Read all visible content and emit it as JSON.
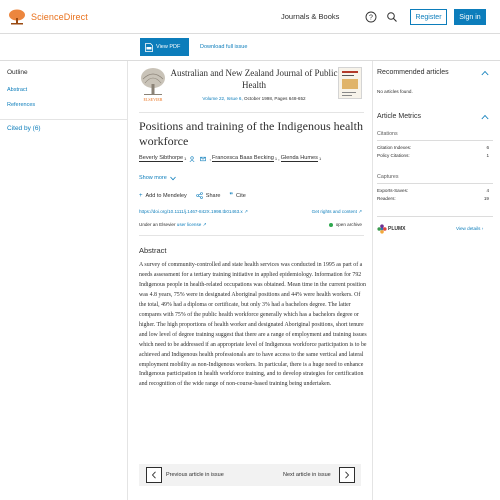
{
  "header": {
    "site_name": "ScienceDirect",
    "journals_books": "Journals & Books",
    "register": "Register",
    "sign_in": "Sign in"
  },
  "toolbar": {
    "view_pdf": "View PDF",
    "download_issue": "Download full issue"
  },
  "left_sidebar": {
    "outline_heading": "Outline",
    "outline_items": [
      "Abstract",
      "References"
    ],
    "cited_by": "Cited by (6)"
  },
  "journal": {
    "title": "Australian and New Zealand Journal of Public Health",
    "volume_info": "Volume 22, Issue 6,",
    "date_pages": "October 1998, Pages 648-652",
    "publisher": "ELSEVIER"
  },
  "article": {
    "title": "Positions and training of the Indigenous health workforce",
    "authors": [
      {
        "name": "Beverly Sibthorpe",
        "sup": "1"
      },
      {
        "name": "Francesca Baas Becking",
        "sup": "1"
      },
      {
        "name": "Glenda Humes",
        "sup": "1"
      }
    ],
    "show_more": "Show more",
    "actions": {
      "add_mendeley": "Add to Mendeley",
      "share": "Share",
      "cite": "Cite"
    },
    "doi": "https://doi.org/10.1111/j.1467-842X.1998.tb01463.x",
    "rights": "Get rights and content",
    "license_prefix": "Under an Elsevier",
    "license_link": "user license",
    "open_archive": "open archive"
  },
  "abstract": {
    "heading": "Abstract",
    "text": "A survey of community-controlled and state health services was conducted in 1995 as part of a needs assessment for a tertiary training initiative in applied epidemiology. Information for 792 Indigenous people in health-related occupations was obtained. Mean time in the current position was 4.8 years, 75% were in designated Aboriginal positions and 44% were health workers. Of the total, 49% had a diploma or certificate, but only 3% had a bachelors degree. The latter compares with 75% of the public health workforce generally which has a bachelors degree or higher. The high proportions of health worker and designated Aboriginal positions, short tenure and low level of degree training suggest that there are a range of employment and training issues which need to be addressed if an appropriate level of Indigenous workforce participation is to be achieved and Indigenous health professionals are to have access to the same vertical and lateral employment mobility as non-Indigenous workers. In particular, there is a huge need to enhance Indigenous participation in health workforce training, and to develop strategies for certification and recognition of the wide range of non-course-based training being undertaken."
  },
  "pager": {
    "previous": "Previous article in issue",
    "next": "Next article in issue"
  },
  "right_sidebar": {
    "recommended_heading": "Recommended articles",
    "recommended_empty": "No articles found.",
    "metrics_heading": "Article Metrics",
    "citations_heading": "Citations",
    "citations": [
      {
        "label": "Citation Indexes:",
        "value": "6"
      },
      {
        "label": "Policy Citations:",
        "value": "1"
      }
    ],
    "captures_heading": "Captures",
    "captures": [
      {
        "label": "Exports-Saves:",
        "value": "4"
      },
      {
        "label": "Readers:",
        "value": "19"
      }
    ],
    "plumx": "PLUMX",
    "view_details": "View details"
  },
  "colors": {
    "brand_orange": "#e9711c",
    "link_blue": "#0c7dbb",
    "open_archive_green": "#2fa84f"
  }
}
